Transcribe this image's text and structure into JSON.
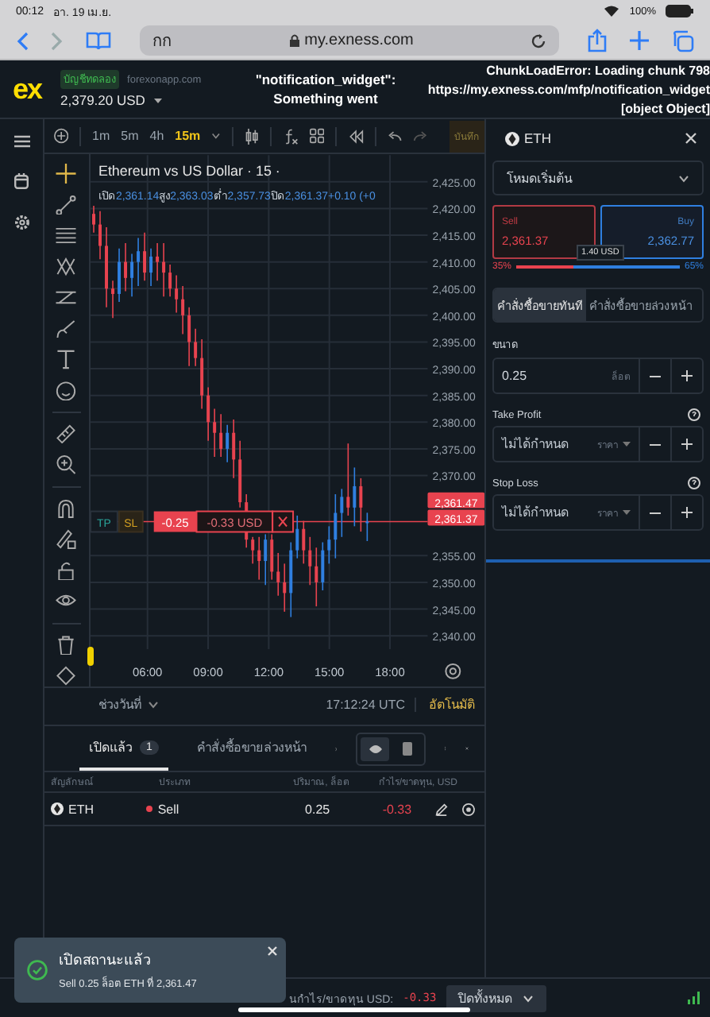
{
  "status_bar": {
    "time": "00:12",
    "date": "อา. 19 เม.ย.",
    "battery": "100%"
  },
  "browser": {
    "tab_text": "กก",
    "url": "my.exness.com"
  },
  "header": {
    "logo": "ex",
    "account_badge": "บัญชีทดลอง",
    "server": "forexonapp.com",
    "balance": "2,379.20 USD",
    "error_center": [
      "\"notification_widget\":",
      "Something went"
    ],
    "error_right": [
      "ChunkLoadError: Loading chunk 798",
      "https://my.exness.com/mfp/notification_widget",
      "[object Object]"
    ]
  },
  "chart_toolbar": {
    "timeframes": [
      {
        "label": "1m",
        "selected": false
      },
      {
        "label": "5m",
        "selected": false
      },
      {
        "label": "4h",
        "selected": false
      },
      {
        "label": "15m",
        "selected": true
      }
    ],
    "save_label": "บันทึก"
  },
  "chart": {
    "title": "Ethereum vs US Dollar · 15 ·",
    "ohlc": [
      {
        "label": "เปิด",
        "value": "2,361.14"
      },
      {
        "label": "สูง",
        "value": "2,363.03"
      },
      {
        "label": "ต่ำ",
        "value": "2,357.73"
      },
      {
        "label": "ปิด",
        "value": "2,361.37"
      }
    ],
    "change": "+0.10 (+0",
    "chart_data": {
      "type": "candlestick",
      "ylim": [
        2337.5,
        2430
      ],
      "grid": true,
      "ref_lines": [
        {
          "axis": "y",
          "value": 2361.37,
          "color": "#e8434f"
        }
      ],
      "categories": [
        null,
        null,
        null,
        null,
        null,
        null,
        null,
        null,
        null,
        null,
        null,
        null,
        null,
        null,
        null,
        null,
        null,
        null,
        null,
        null,
        null,
        null,
        null,
        null,
        null,
        null,
        null,
        null,
        null,
        null,
        null,
        null,
        null,
        null,
        null,
        null,
        null,
        null,
        null,
        null,
        null,
        null,
        null,
        null,
        null,
        null,
        null,
        null,
        null,
        null,
        null,
        null,
        null
      ],
      "yticks": [
        {
          "value": 2425,
          "label": "2,425.00"
        },
        {
          "value": 2420,
          "label": "2,420.00"
        },
        {
          "value": 2415,
          "label": "2,415.00"
        },
        {
          "value": 2410,
          "label": "2,410.00"
        },
        {
          "value": 2405,
          "label": "2,405.00"
        },
        {
          "value": 2400,
          "label": "2,400.00"
        },
        {
          "value": 2395,
          "label": "2,395.00"
        },
        {
          "value": 2390,
          "label": "2,390.00"
        },
        {
          "value": 2385,
          "label": "2,385.00"
        },
        {
          "value": 2380,
          "label": "2,380.00"
        },
        {
          "value": 2375,
          "label": "2,375.00"
        },
        {
          "value": 2370,
          "label": "2,370.00"
        },
        {
          "value": 2355,
          "label": "2,355.00"
        },
        {
          "value": 2350,
          "label": "2,350.00"
        },
        {
          "value": 2345,
          "label": "2,345.00"
        },
        {
          "value": 2340,
          "label": "2,340.00"
        }
      ],
      "ohlc": [
        [
          2419,
          2420.5,
          2415.5,
          2417
        ],
        [
          2417,
          2419.5,
          2410.5,
          2413
        ],
        [
          2413,
          2416.5,
          2401.5,
          2405
        ],
        [
          2405,
          2406.5,
          2399.5,
          2404
        ],
        [
          2404,
          2412.5,
          2402.5,
          2410
        ],
        [
          2410,
          2413.5,
          2404.5,
          2407
        ],
        [
          2407,
          2411.5,
          2403.5,
          2410
        ],
        [
          2410,
          2414.5,
          2405.5,
          2412
        ],
        [
          2412,
          2415.5,
          2406.5,
          2408
        ],
        [
          2408,
          2412.5,
          2405.5,
          2411
        ],
        [
          2411,
          2413.5,
          2406.5,
          2410
        ],
        [
          2410,
          2413.5,
          2403.5,
          2408
        ],
        [
          2408,
          2409.5,
          2403.5,
          2405
        ],
        [
          2405,
          2407.5,
          2400.5,
          2403
        ],
        [
          2403,
          2405.5,
          2396.5,
          2400
        ],
        [
          2400,
          2401.5,
          2390.5,
          2395
        ],
        [
          2395,
          2397.5,
          2390.5,
          2392
        ],
        [
          2392,
          2395.5,
          2382.5,
          2385
        ],
        [
          2385,
          2386.5,
          2376.5,
          2380
        ],
        [
          2380,
          2382.5,
          2373.5,
          2378
        ],
        [
          2378,
          2381.5,
          2373.5,
          2375
        ],
        [
          2375,
          2379.5,
          2372.5,
          2378
        ],
        [
          2378,
          2380.5,
          2369.5,
          2373
        ],
        [
          2373,
          2376.5,
          2364,
          2365
        ],
        [
          2365,
          2366.5,
          2356.5,
          2358
        ],
        [
          2358,
          2358.5,
          2353.5,
          2356
        ],
        [
          2356,
          2358.5,
          2350.5,
          2354
        ],
        [
          2354,
          2359,
          2349.5,
          2358
        ],
        [
          2358,
          2359,
          2350.5,
          2352
        ],
        [
          2352,
          2355.5,
          2347.5,
          2350
        ],
        [
          2350,
          2353.5,
          2344.5,
          2348
        ],
        [
          2348,
          2357.5,
          2343.5,
          2356
        ],
        [
          2356,
          2362.5,
          2354.5,
          2360
        ],
        [
          2360,
          2361.5,
          2353.5,
          2356
        ],
        [
          2356,
          2358.5,
          2349.5,
          2353
        ],
        [
          2353,
          2356.5,
          2345.5,
          2350
        ],
        [
          2350,
          2357.5,
          2348.5,
          2356
        ],
        [
          2356,
          2360.5,
          2353.5,
          2358
        ],
        [
          2358,
          2366.5,
          2354.5,
          2363
        ],
        [
          2363,
          2367.5,
          2358.5,
          2366
        ],
        [
          2366,
          2376,
          2362.5,
          2364
        ],
        [
          2364,
          2371.5,
          2360.5,
          2368
        ],
        [
          2368,
          2369.5,
          2359.5,
          2364
        ],
        [
          2361.14,
          2363.03,
          2357.73,
          2361.37
        ],
        null,
        null,
        null,
        null,
        null,
        null,
        null,
        null,
        null
      ]
    },
    "price_tags": [
      "2,361.47",
      "2,361.37"
    ],
    "time_axis": [
      "06:00",
      "09:00",
      "12:00",
      "15:00",
      "18:00"
    ],
    "position_line": {
      "tp": "TP",
      "sl": "SL",
      "volume": "-0.25",
      "pnl": "-0.33 USD"
    }
  },
  "chart_footer": {
    "range": "ช่วงวันที่",
    "time": "17:12:24 UTC",
    "auto": "อัตโนมัติ"
  },
  "order_panel": {
    "symbol": "ETH",
    "mode": "โหมดเริ่มต้น",
    "sell": {
      "label": "Sell",
      "price": "2,361.37"
    },
    "buy": {
      "label": "Buy",
      "price": "2,362.77"
    },
    "spread": "1.40 USD",
    "sentiment": {
      "sell_pct": "35%",
      "buy_pct": "65%",
      "level": 0.35
    },
    "order_tabs": [
      {
        "label": "คำสั่งซื้อขายทันที",
        "selected": true
      },
      {
        "label": "คำสั่งซื้อขายล่วงหน้า",
        "selected": false
      }
    ],
    "volume": {
      "label": "ขนาด",
      "value": "0.25",
      "unit": "ล็อต"
    },
    "take_profit": {
      "label": "Take Profit",
      "value": "ไม่ได้กำหนด",
      "unit": "ราคา"
    },
    "stop_loss": {
      "label": "Stop Loss",
      "value": "ไม่ได้กำหนด",
      "unit": "ราคา"
    }
  },
  "positions": {
    "tabs": [
      {
        "label": "เปิดแล้ว",
        "count": "1",
        "selected": true
      },
      {
        "label": "คำสั่งซื้อขายล่วงหน้า",
        "selected": false
      }
    ],
    "view_toggle": [
      {
        "selected": true
      },
      {
        "selected": false
      }
    ],
    "columns": [
      "สัญลักษณ์",
      "ประเภท",
      "ปริมาณ, ล็อต",
      "กำไร/ขาดทุน, USD"
    ],
    "rows": [
      {
        "symbol": "ETH",
        "type": "Sell",
        "volume": "0.25",
        "pnl": "-0.33"
      }
    ]
  },
  "footer": {
    "pnl_label": "นกำไร/ขาดทุน USD:",
    "pnl": "-0.33",
    "close_all": "ปิดทั้งหมด"
  },
  "toast": {
    "title": "เปิดสถานะแล้ว",
    "message": "Sell 0.25 ล็อต ETH ที่ 2,361.47"
  }
}
